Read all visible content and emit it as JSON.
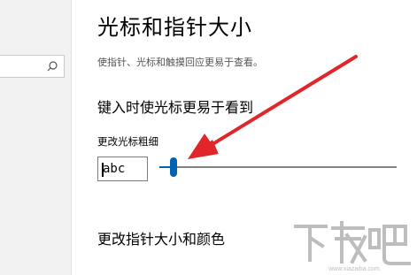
{
  "page": {
    "title": "光标和指针大小",
    "description": "使指针、光标和触摸回应更易于查看。"
  },
  "cursor_section": {
    "heading": "键入时使光标更易于看到",
    "thickness_label": "更改光标粗细",
    "preview_text": "abc",
    "thickness_level": 0.05
  },
  "pointer_section": {
    "heading": "更改指针大小和颜色"
  },
  "sidebar": {
    "search_icon": "search-icon"
  },
  "annotation": {
    "color": "#e0262b"
  },
  "watermark": {
    "logo_text": "下载吧",
    "site": "www.xiazaiba.com"
  },
  "colors": {
    "accent": "#0063b1",
    "track": "#808080"
  }
}
